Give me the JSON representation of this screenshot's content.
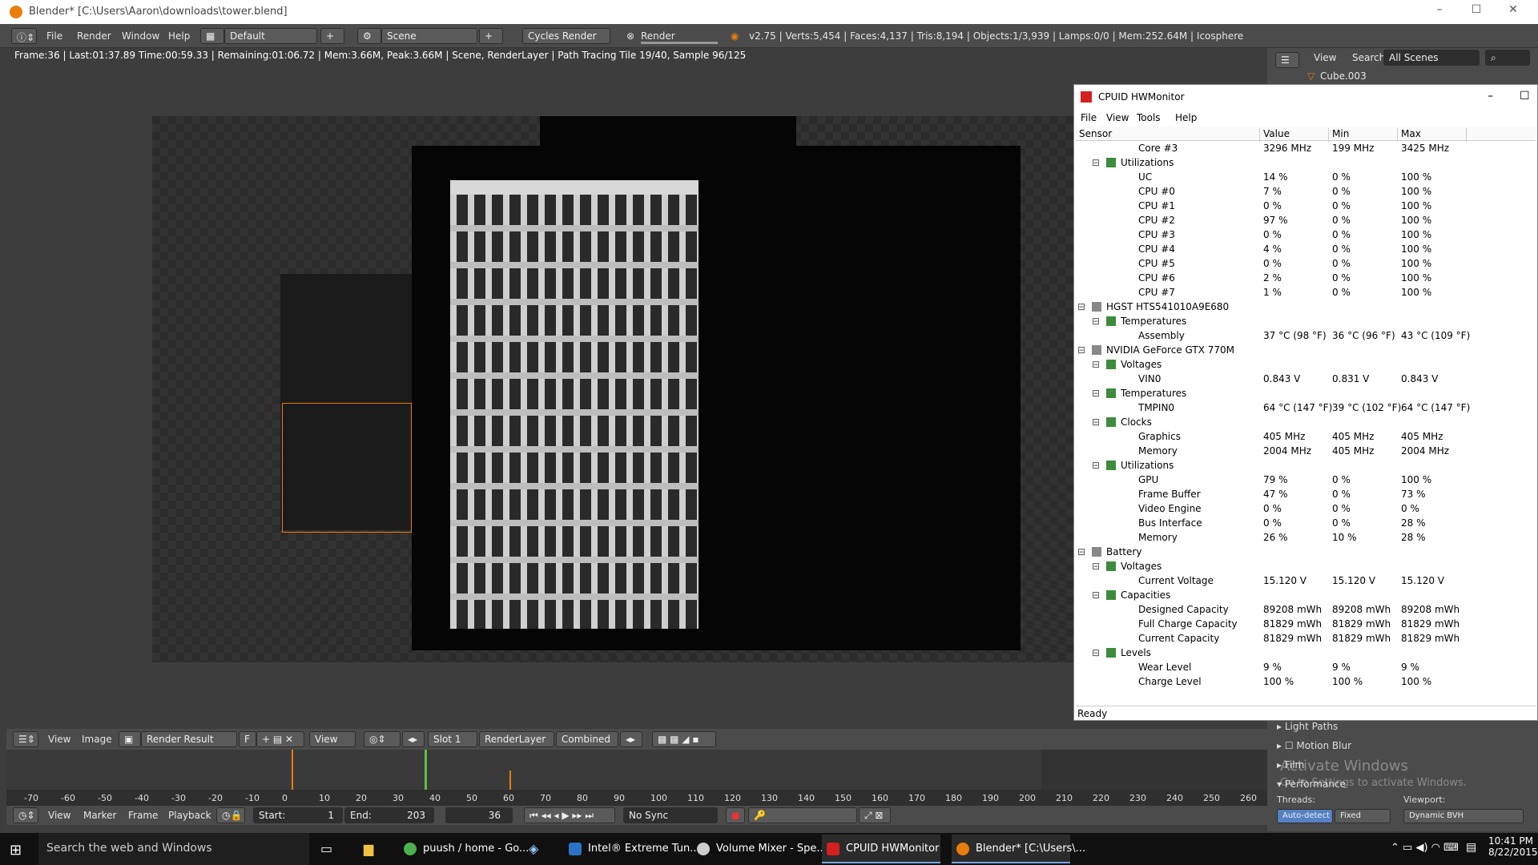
{
  "window": {
    "title": "Blender* [C:\\Users\\Aaron\\downloads\\tower.blend]"
  },
  "info_header": {
    "menus": [
      "File",
      "Render",
      "Window",
      "Help"
    ],
    "layout": "Default",
    "scene": "Scene",
    "engine": "Cycles Render",
    "render_label": "Render",
    "stats": "v2.75 | Verts:5,454 | Faces:4,137 | Tris:8,194 | Objects:1/3,939 | Lamps:0/0 | Mem:252.64M | Icosphere"
  },
  "render_status": "Frame:36 | Last:01:37.89 Time:00:59.33 | Remaining:01:06.72 | Mem:3.66M, Peak:3.66M | Scene, RenderLayer | Path Tracing Tile 19/40, Sample 96/125",
  "outliner": {
    "view": "View",
    "search": "Search",
    "scenes": "All Scenes",
    "object": "Cube.003"
  },
  "hwmonitor": {
    "title": "CPUID HWMonitor",
    "menus": [
      "File",
      "View",
      "Tools",
      "Help"
    ],
    "columns": [
      "Sensor",
      "Value",
      "Min",
      "Max"
    ],
    "rows": [
      {
        "level": 3,
        "name": "Core #3",
        "value": "3296 MHz",
        "min": "199 MHz",
        "max": "3425 MHz"
      },
      {
        "level": 2,
        "name": "Utilizations",
        "value": "",
        "min": "",
        "max": ""
      },
      {
        "level": 3,
        "name": "UC",
        "value": "14 %",
        "min": "0 %",
        "max": "100 %"
      },
      {
        "level": 3,
        "name": "CPU #0",
        "value": "7 %",
        "min": "0 %",
        "max": "100 %"
      },
      {
        "level": 3,
        "name": "CPU #1",
        "value": "0 %",
        "min": "0 %",
        "max": "100 %"
      },
      {
        "level": 3,
        "name": "CPU #2",
        "value": "97 %",
        "min": "0 %",
        "max": "100 %"
      },
      {
        "level": 3,
        "name": "CPU #3",
        "value": "0 %",
        "min": "0 %",
        "max": "100 %"
      },
      {
        "level": 3,
        "name": "CPU #4",
        "value": "4 %",
        "min": "0 %",
        "max": "100 %"
      },
      {
        "level": 3,
        "name": "CPU #5",
        "value": "0 %",
        "min": "0 %",
        "max": "100 %"
      },
      {
        "level": 3,
        "name": "CPU #6",
        "value": "2 %",
        "min": "0 %",
        "max": "100 %"
      },
      {
        "level": 3,
        "name": "CPU #7",
        "value": "1 %",
        "min": "0 %",
        "max": "100 %"
      },
      {
        "level": 1,
        "name": "HGST HTS541010A9E680",
        "value": "",
        "min": "",
        "max": ""
      },
      {
        "level": 2,
        "name": "Temperatures",
        "value": "",
        "min": "",
        "max": ""
      },
      {
        "level": 3,
        "name": "Assembly",
        "value": "37 °C  (98 °F)",
        "min": "36 °C  (96 °F)",
        "max": "43 °C  (109 °F)"
      },
      {
        "level": 1,
        "name": "NVIDIA GeForce GTX 770M",
        "value": "",
        "min": "",
        "max": ""
      },
      {
        "level": 2,
        "name": "Voltages",
        "value": "",
        "min": "",
        "max": ""
      },
      {
        "level": 3,
        "name": "VIN0",
        "value": "0.843 V",
        "min": "0.831 V",
        "max": "0.843 V"
      },
      {
        "level": 2,
        "name": "Temperatures",
        "value": "",
        "min": "",
        "max": ""
      },
      {
        "level": 3,
        "name": "TMPIN0",
        "value": "64 °C  (147 °F)",
        "min": "39 °C  (102 °F)",
        "max": "64 °C  (147 °F)"
      },
      {
        "level": 2,
        "name": "Clocks",
        "value": "",
        "min": "",
        "max": ""
      },
      {
        "level": 3,
        "name": "Graphics",
        "value": "405 MHz",
        "min": "405 MHz",
        "max": "405 MHz"
      },
      {
        "level": 3,
        "name": "Memory",
        "value": "2004 MHz",
        "min": "405 MHz",
        "max": "2004 MHz"
      },
      {
        "level": 2,
        "name": "Utilizations",
        "value": "",
        "min": "",
        "max": ""
      },
      {
        "level": 3,
        "name": "GPU",
        "value": "79 %",
        "min": "0 %",
        "max": "100 %"
      },
      {
        "level": 3,
        "name": "Frame Buffer",
        "value": "47 %",
        "min": "0 %",
        "max": "73 %"
      },
      {
        "level": 3,
        "name": "Video Engine",
        "value": "0 %",
        "min": "0 %",
        "max": "0 %"
      },
      {
        "level": 3,
        "name": "Bus Interface",
        "value": "0 %",
        "min": "0 %",
        "max": "28 %"
      },
      {
        "level": 3,
        "name": "Memory",
        "value": "26 %",
        "min": "10 %",
        "max": "28 %"
      },
      {
        "level": 1,
        "name": "Battery",
        "value": "",
        "min": "",
        "max": ""
      },
      {
        "level": 2,
        "name": "Voltages",
        "value": "",
        "min": "",
        "max": ""
      },
      {
        "level": 3,
        "name": "Current Voltage",
        "value": "15.120 V",
        "min": "15.120 V",
        "max": "15.120 V"
      },
      {
        "level": 2,
        "name": "Capacities",
        "value": "",
        "min": "",
        "max": ""
      },
      {
        "level": 3,
        "name": "Designed Capacity",
        "value": "89208 mWh",
        "min": "89208 mWh",
        "max": "89208 mWh"
      },
      {
        "level": 3,
        "name": "Full Charge Capacity",
        "value": "81829 mWh",
        "min": "81829 mWh",
        "max": "81829 mWh"
      },
      {
        "level": 3,
        "name": "Current Capacity",
        "value": "81829 mWh",
        "min": "81829 mWh",
        "max": "81829 mWh"
      },
      {
        "level": 2,
        "name": "Levels",
        "value": "",
        "min": "",
        "max": ""
      },
      {
        "level": 3,
        "name": "Wear Level",
        "value": "9 %",
        "min": "9 %",
        "max": "9 %"
      },
      {
        "level": 3,
        "name": "Charge Level",
        "value": "100 %",
        "min": "100 %",
        "max": "100 %"
      }
    ],
    "status": "Ready"
  },
  "properties": {
    "items": [
      "Light Paths",
      "Motion Blur",
      "Film",
      "Performance"
    ],
    "threads": "Threads:",
    "auto_detect": "Auto-detect",
    "fixed": "Fixed",
    "viewport": "Viewport:",
    "dynamic_bvh": "Dynamic BVH",
    "activate": "Activate Windows",
    "activate_sub": "Go to Settings to activate Windows."
  },
  "image_header": {
    "menus": [
      "View",
      "Image"
    ],
    "image": "Render Result",
    "f": "F",
    "view": "View",
    "slot": "Slot 1",
    "layer": "RenderLayer",
    "pass": "Combined"
  },
  "timeline": {
    "menus": [
      "View",
      "Marker",
      "Frame",
      "Playback"
    ],
    "start": "Start:",
    "start_val": "1",
    "end": "End:",
    "end_val": "203",
    "current": "36",
    "sync": "No Sync",
    "ticks": [
      "-70",
      "-60",
      "-50",
      "-40",
      "-30",
      "-20",
      "-10",
      "0",
      "10",
      "20",
      "30",
      "40",
      "50",
      "60",
      "70",
      "80",
      "90",
      "100",
      "110",
      "120",
      "130",
      "140",
      "150",
      "160",
      "170",
      "180",
      "190",
      "200",
      "210",
      "220",
      "230",
      "240",
      "250",
      "260"
    ]
  },
  "taskbar": {
    "search": "Search the web and Windows",
    "apps": [
      "puush / home - Go...",
      "Intel® Extreme Tun...",
      "Volume Mixer - Spe...",
      "CPUID HWMonitor",
      "Blender* [C:\\Users\\..."
    ],
    "time": "10:41 PM",
    "date": "8/22/2015"
  },
  "colors": {
    "accent": "#e87d0d",
    "hw_red": "#d42020"
  }
}
